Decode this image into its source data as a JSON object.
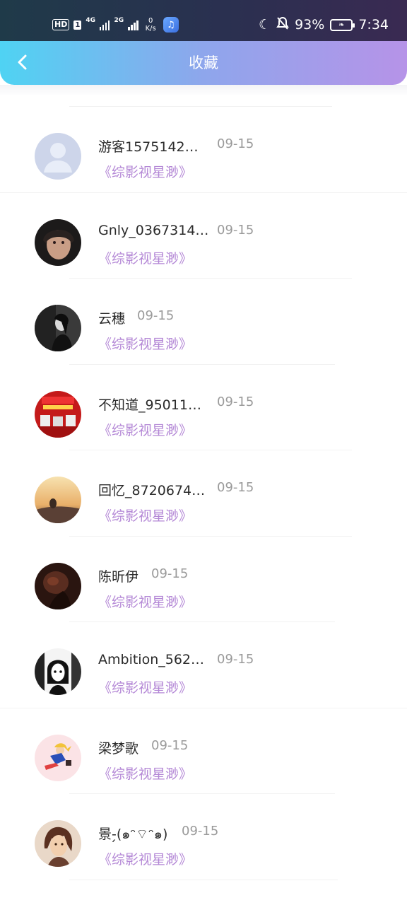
{
  "status_bar": {
    "hd": "HD",
    "sim": "1",
    "net1": "4G",
    "net2": "2G",
    "speed_value": "0",
    "speed_unit": "K/s",
    "battery": "93%",
    "time": "7:34"
  },
  "header": {
    "title": "收藏",
    "back_icon": "chevron-left-icon",
    "gradient_start": "#4fd3f3",
    "gradient_end": "#b693e8"
  },
  "list": {
    "items": [
      {
        "name": "游客1575142…",
        "date": "09-15",
        "work": "《综影视星渺》",
        "avatar": "default-avatar"
      },
      {
        "name": "Gnly_0367314…",
        "date": "09-15",
        "work": "《综影视星渺》",
        "avatar": "photo-girl"
      },
      {
        "name": "云穗",
        "date": "09-15",
        "work": "《综影视星渺》",
        "avatar": "photo-bw"
      },
      {
        "name": "不知道_95011…",
        "date": "09-15",
        "work": "《综影视星渺》",
        "avatar": "photo-red-poster"
      },
      {
        "name": "回忆_8720674…",
        "date": "09-15",
        "work": "《综影视星渺》",
        "avatar": "photo-sunset"
      },
      {
        "name": "陈昕伊",
        "date": "09-15",
        "work": "《综影视星渺》",
        "avatar": "photo-dark"
      },
      {
        "name": "Ambition_562…",
        "date": "09-15",
        "work": "《综影视星渺》",
        "avatar": "illustration-girl"
      },
      {
        "name": "梁梦歌",
        "date": "09-15",
        "work": "《综影视星渺》",
        "avatar": "anime-sailor"
      },
      {
        "name": "景-̗(๑ᵔ⌔ᵔ๑)",
        "date": "09-15",
        "work": "《综影视星渺》",
        "avatar": "anime-man"
      }
    ]
  },
  "colors": {
    "work_title": "#b488d6",
    "date": "#9a9a9a",
    "name": "#2b2b2b"
  }
}
